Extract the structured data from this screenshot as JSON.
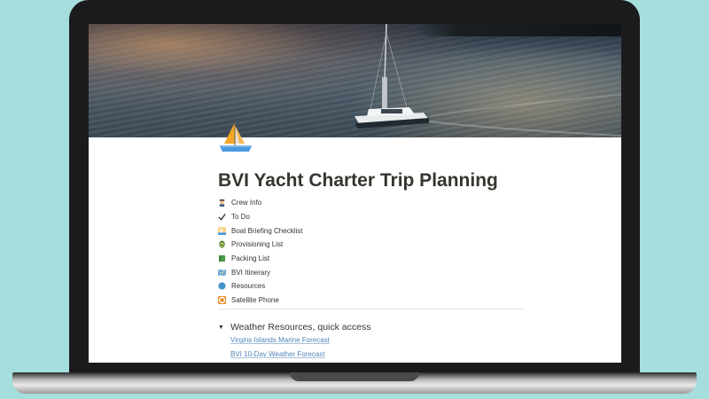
{
  "page": {
    "title": "BVI Yacht Charter Trip Planning",
    "icon": "sailboat-icon"
  },
  "links": [
    {
      "icon": "sailor-icon",
      "label": "Crew Info"
    },
    {
      "icon": "checkmark-icon",
      "label": "To Do"
    },
    {
      "icon": "sunset-boat-icon",
      "label": "Boat Briefing Checklist"
    },
    {
      "icon": "avocado-icon",
      "label": "Provisioning List"
    },
    {
      "icon": "green-book-icon",
      "label": "Packing List"
    },
    {
      "icon": "map-icon",
      "label": "BVI Itinerary"
    },
    {
      "icon": "globe-icon",
      "label": "Resources"
    },
    {
      "icon": "lifebuoy-icon",
      "label": "Satellite Phone"
    }
  ],
  "weather": {
    "heading": "Weather Resources, quick access",
    "links": [
      "Virgins Islands Marine Forecast",
      "BVI 10-Day Weather Forecast"
    ]
  },
  "colors": {
    "background": "#a6dede",
    "text": "#37352f",
    "link": "#4f86b8"
  }
}
